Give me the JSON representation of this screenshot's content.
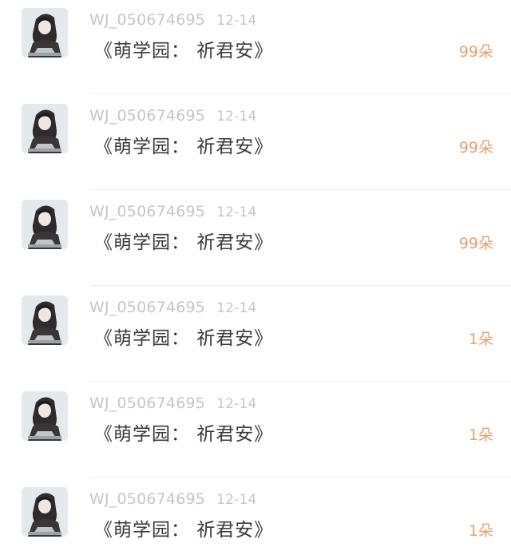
{
  "gift_list": [
    {
      "user": "WJ_050674695",
      "date": "12-14",
      "message": "《萌学园： 祈君安》",
      "amount": "99朵"
    },
    {
      "user": "WJ_050674695",
      "date": "12-14",
      "message": "《萌学园： 祈君安》",
      "amount": "99朵"
    },
    {
      "user": "WJ_050674695",
      "date": "12-14",
      "message": "《萌学园： 祈君安》",
      "amount": "99朵"
    },
    {
      "user": "WJ_050674695",
      "date": "12-14",
      "message": "《萌学园： 祈君安》",
      "amount": "1朵"
    },
    {
      "user": "WJ_050674695",
      "date": "12-14",
      "message": "《萌学园： 祈君安》",
      "amount": "1朵"
    },
    {
      "user": "WJ_050674695",
      "date": "12-14",
      "message": "《萌学园： 祈君安》",
      "amount": "1朵"
    }
  ],
  "colors": {
    "meta_text": "#c6c6c6",
    "message_text": "#3a3a3a",
    "amount_text": "#e3a16b",
    "divider": "#efefef"
  }
}
